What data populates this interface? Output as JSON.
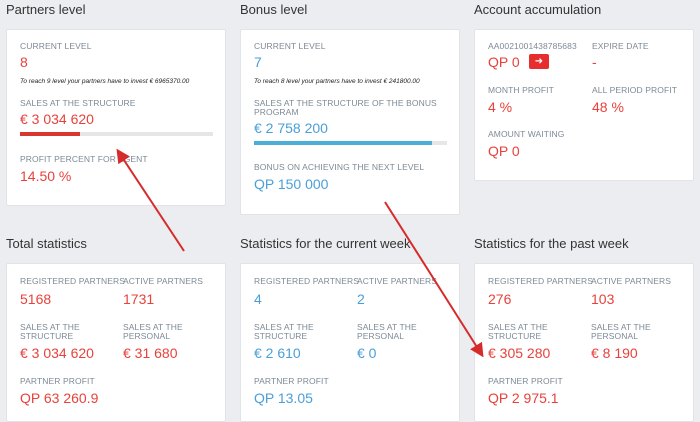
{
  "partners_level": {
    "title": "Partners level",
    "current_level_label": "CURRENT LEVEL",
    "current_level": "8",
    "note": "To reach 9 level your partners have to invest € 6965370.00",
    "sales_label": "SALES AT THE STRUCTURE",
    "sales_value": "€ 3 034 620",
    "sales_progress": 0.31,
    "profit_label": "PROFIT PERCENT FOR AGENT",
    "profit_value": "14.50 %"
  },
  "bonus_level": {
    "title": "Bonus level",
    "current_level_label": "CURRENT LEVEL",
    "current_level": "7",
    "note": "To reach 8 level your partners have to invest € 241800.00",
    "sales_label_1": "SALES AT THE STRUCTURE OF THE BONUS",
    "sales_label_2": "PROGRAM",
    "sales_value": "€ 2 758 200",
    "sales_progress": 0.92,
    "bonus_label": "BONUS ON ACHIEVING THE NEXT LEVEL",
    "bonus_value": "QP 150 000"
  },
  "account": {
    "title": "Account accumulation",
    "account_id": "AA0021001438785683",
    "balance": "QP 0",
    "go_icon": "arrow-right-icon",
    "expire_label": "EXPIRE DATE",
    "expire_value": "-",
    "month_profit_label": "MONTH PROFIT",
    "month_profit_value": "4 %",
    "all_period_label": "ALL PERIOD PROFIT",
    "all_period_value": "48 %",
    "waiting_label": "AMOUNT WAITING",
    "waiting_value": "QP 0"
  },
  "total_stats": {
    "title": "Total statistics",
    "registered_label": "REGISTERED PARTNERS",
    "registered_value": "5168",
    "active_label": "ACTIVE PARTNERS",
    "active_value": "1731",
    "sales_structure_label_1": "SALES AT THE",
    "sales_structure_label_2": "STRUCTURE",
    "sales_structure_value": "€ 3 034 620",
    "sales_personal_label_1": "SALES AT THE",
    "sales_personal_label_2": "PERSONAL",
    "sales_personal_value": "€ 31 680",
    "partner_profit_label": "PARTNER PROFIT",
    "partner_profit_value": "QP 63 260.9"
  },
  "current_week": {
    "title": "Statistics for the current week",
    "registered_label": "REGISTERED PARTNERS",
    "registered_value": "4",
    "active_label": "ACTIVE PARTNERS",
    "active_value": "2",
    "sales_structure_label_1": "SALES AT THE",
    "sales_structure_label_2": "STRUCTURE",
    "sales_structure_value": "€ 2 610",
    "sales_personal_label_1": "SALES AT THE",
    "sales_personal_label_2": "PERSONAL",
    "sales_personal_value": "€ 0",
    "partner_profit_label": "PARTNER PROFIT",
    "partner_profit_value": "QP 13.05"
  },
  "past_week": {
    "title": "Statistics for the past week",
    "registered_label": "REGISTERED PARTNERS",
    "registered_value": "276",
    "active_label": "ACTIVE PARTNERS",
    "active_value": "103",
    "sales_structure_label_1": "SALES AT THE",
    "sales_structure_label_2": "STRUCTURE",
    "sales_structure_value": "€ 305 280",
    "sales_personal_label_1": "SALES AT THE",
    "sales_personal_label_2": "PERSONAL",
    "sales_personal_value": "€ 8 190",
    "partner_profit_label": "PARTNER PROFIT",
    "partner_profit_value": "QP 2 975.1"
  },
  "colors": {
    "accent_red": "#e8413c",
    "accent_blue": "#4a9fd8",
    "progress_red": "#d9362f",
    "progress_blue": "#4aaed6",
    "annotation_arrow": "#d62b2b"
  }
}
